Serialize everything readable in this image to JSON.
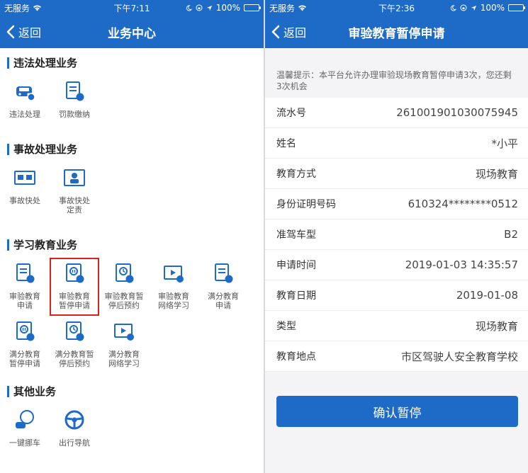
{
  "left": {
    "status": {
      "carrier": "无服务",
      "time": "下午7:11",
      "battery": "100%"
    },
    "nav": {
      "back": "返回",
      "title": "业务中心"
    },
    "sections": [
      {
        "title": "违法处理业务",
        "items": [
          {
            "label": "违法处理",
            "icon": "car-icon"
          },
          {
            "label": "罚款缴纳",
            "icon": "document-icon"
          }
        ]
      },
      {
        "title": "事故处理业务",
        "items": [
          {
            "label": "事故快处",
            "icon": "accident-icon"
          },
          {
            "label": "事故快处\n定责",
            "icon": "accident-responsibility-icon"
          }
        ]
      },
      {
        "title": "学习教育业务",
        "items": [
          {
            "label": "审验教育\n申请",
            "icon": "document-icon"
          },
          {
            "label": "审验教育\n暂停申请",
            "icon": "pause-document-icon",
            "highlight": true
          },
          {
            "label": "审验教育暂\n停后预约",
            "icon": "clock-document-icon"
          },
          {
            "label": "审验教育\n网络学习",
            "icon": "video-icon"
          },
          {
            "label": "满分教育\n申请",
            "icon": "document-icon"
          },
          {
            "label": "满分教育\n暂停申请",
            "icon": "pause-document-icon"
          },
          {
            "label": "满分教育暂\n停后预约",
            "icon": "clock-document-icon"
          },
          {
            "label": "满分教育\n网络学习",
            "icon": "video-icon"
          }
        ]
      },
      {
        "title": "其他业务",
        "items": [
          {
            "label": "一键挪车",
            "icon": "move-car-icon"
          },
          {
            "label": "出行导航",
            "icon": "steering-wheel-icon"
          }
        ]
      }
    ]
  },
  "right": {
    "status": {
      "carrier": "无服务",
      "time": "下午2:36",
      "battery": "100%"
    },
    "nav": {
      "back": "返回",
      "title": "审验教育暂停申请"
    },
    "tip": "温馨提示：本平台允许办理审验现场教育暂停申请3次，您还剩3次机会",
    "rows": [
      {
        "key": "流水号",
        "value": "261001901030075945"
      },
      {
        "key": "姓名",
        "value": "*小平"
      },
      {
        "key": "教育方式",
        "value": "现场教育"
      },
      {
        "key": "身份证明号码",
        "value": "610324********0512"
      },
      {
        "key": "准驾车型",
        "value": "B2"
      },
      {
        "key": "申请时间",
        "value": "2019-01-03 14:35:57"
      },
      {
        "key": "教育日期",
        "value": "2019-01-08"
      },
      {
        "key": "类型",
        "value": "现场教育"
      },
      {
        "key": "教育地点",
        "value": "市区驾驶人安全教育学校"
      }
    ],
    "confirm_label": "确认暂停"
  },
  "colors": {
    "primary": "#1e6bc7",
    "highlight": "#d9221c",
    "battery": "#3ddc5a"
  }
}
